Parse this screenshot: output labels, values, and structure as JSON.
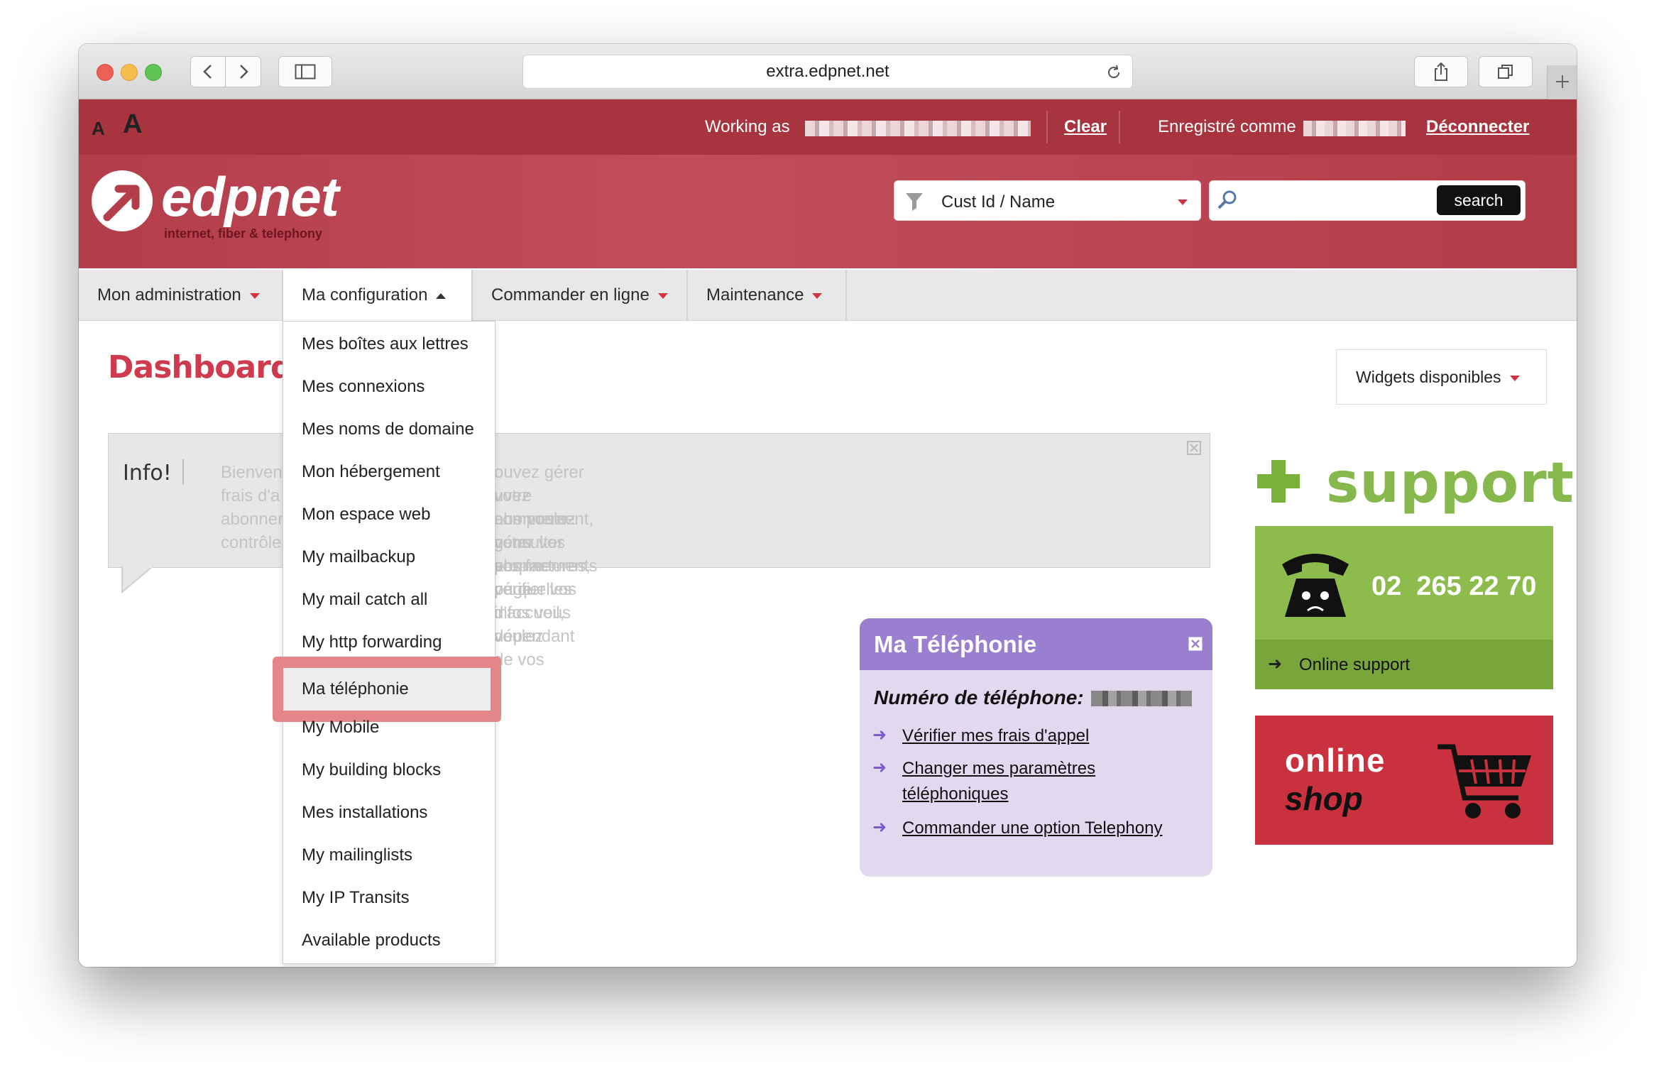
{
  "browser": {
    "url": "extra.edpnet.net",
    "traffic_lights": [
      "close-button",
      "minimize-button",
      "zoom-button"
    ]
  },
  "topbar": {
    "font_small": "A",
    "font_large": "A",
    "working_as_label": "Working as",
    "clear_link": "Clear",
    "registered_label": "Enregistré comme",
    "logout_link": "Déconnecter"
  },
  "header": {
    "logo_name": "edpnet",
    "logo_tagline": "internet, fiber & telephony",
    "filter_select": "Cust Id / Name",
    "search_placeholder": "",
    "search_button": "search"
  },
  "nav": {
    "items": [
      {
        "label": "Mon administration",
        "open": false
      },
      {
        "label": "Ma configuration",
        "open": true
      },
      {
        "label": "Commander en ligne",
        "open": false
      },
      {
        "label": "Maintenance",
        "open": false
      }
    ]
  },
  "dropdown": {
    "items": [
      {
        "label": "Mes boîtes aux lettres"
      },
      {
        "label": "Mes connexions"
      },
      {
        "label": "Mes noms de domaine"
      },
      {
        "label": "Mon hébergement"
      },
      {
        "label": "Mon espace web"
      },
      {
        "label": "My mailbackup"
      },
      {
        "label": "My mail catch all"
      },
      {
        "label": "My http forwarding"
      },
      {
        "label": "Ma téléphonie",
        "highlighted": true
      },
      {
        "label": "My Mobile"
      },
      {
        "label": "My building blocks"
      },
      {
        "label": "Mes installations"
      },
      {
        "label": "My mailinglists"
      },
      {
        "label": "My IP Transits"
      },
      {
        "label": "Available products"
      }
    ]
  },
  "dashboard": {
    "title": "Dashboard",
    "widgets_button": "Widgets disponibles"
  },
  "info": {
    "label": "Info!",
    "line1a": "Bienven",
    "line1b": "ouvez gérer votre abonnement, consulter vos factures, vérifier vos",
    "line2a": "frais d'a",
    "line2b": "uvez composer votre propre page d'accueil, dépendant de vos",
    "line3a": "abonner",
    "line3b": "ous voulez gérer vos abonnements ou quelles infos vous voulez",
    "line4a": "contrôle"
  },
  "telephony_widget": {
    "title": "Ma Téléphonie",
    "number_label": "Numéro de téléphone:",
    "links": [
      {
        "text": "Vérifier mes frais d'appel"
      },
      {
        "text": "Changer mes paramètres",
        "text2": "téléphoniques"
      },
      {
        "text": "Commander une option Telephony"
      }
    ]
  },
  "support": {
    "logo_text": "support",
    "phone": "02  265 22 70",
    "online_support": "Online support"
  },
  "shop": {
    "line1": "online",
    "line2": "shop"
  },
  "colors": {
    "brand_red": "#a8343f",
    "dashboard_title": "#d03a4e",
    "telephony_header": "#9a7fd1",
    "telephony_body": "#e2d8f0",
    "support_green": "#8dbb4c",
    "support_bar": "#78a63a",
    "shop_red": "#c8313d",
    "highlight": "#e5868a"
  }
}
